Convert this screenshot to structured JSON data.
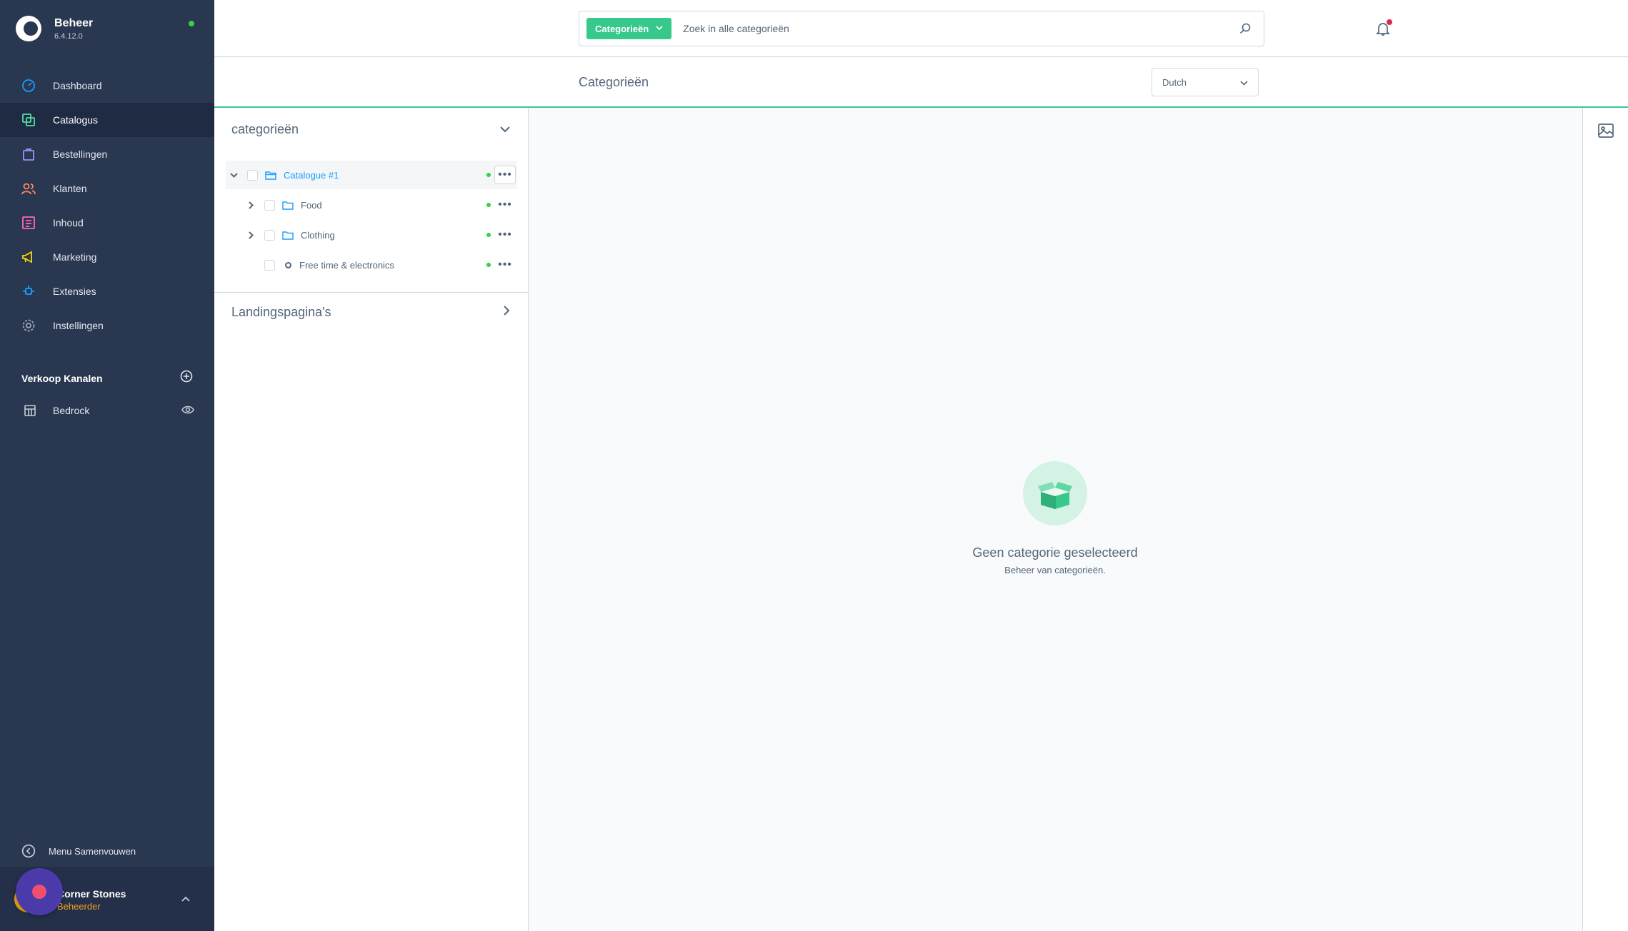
{
  "brand": {
    "title": "Beheer",
    "version": "6.4.12.0"
  },
  "nav": [
    {
      "label": "Dashboard",
      "icon": "dashboard-icon",
      "color": "#189eff"
    },
    {
      "label": "Catalogus",
      "icon": "catalog-icon",
      "color": "#57d9a3",
      "active": true
    },
    {
      "label": "Bestellingen",
      "icon": "orders-icon",
      "color": "#a092f0"
    },
    {
      "label": "Klanten",
      "icon": "customers-icon",
      "color": "#f88962"
    },
    {
      "label": "Inhoud",
      "icon": "content-icon",
      "color": "#ff68b4"
    },
    {
      "label": "Marketing",
      "icon": "marketing-icon",
      "color": "#ffd700"
    },
    {
      "label": "Extensies",
      "icon": "extensions-icon",
      "color": "#189eff"
    },
    {
      "label": "Instellingen",
      "icon": "settings-icon",
      "color": "#9aa8b5"
    }
  ],
  "sales_channels": {
    "title": "Verkoop Kanalen",
    "items": [
      {
        "label": "Bedrock"
      }
    ]
  },
  "collapse_label": "Menu Samenvouwen",
  "user": {
    "name": "Corner Stones",
    "role": "Beheerder"
  },
  "search": {
    "tag": "Categorieën",
    "placeholder": "Zoek in alle categorieën"
  },
  "page": {
    "title": "Categorieën",
    "language": "Dutch"
  },
  "tree": {
    "title": "categorieën",
    "rows": [
      {
        "label": "Catalogue #1"
      },
      {
        "label": "Food"
      },
      {
        "label": "Clothing"
      },
      {
        "label": "Free time & electronics"
      }
    ],
    "landing_title": "Landingspagina's"
  },
  "empty_state": {
    "title": "Geen categorie geselecteerd",
    "subtitle": "Beheer van categorieën."
  },
  "colors": {
    "accent": "#37c98b",
    "sidebar": "#2a3750",
    "link": "#189eff",
    "status": "#37d046"
  }
}
